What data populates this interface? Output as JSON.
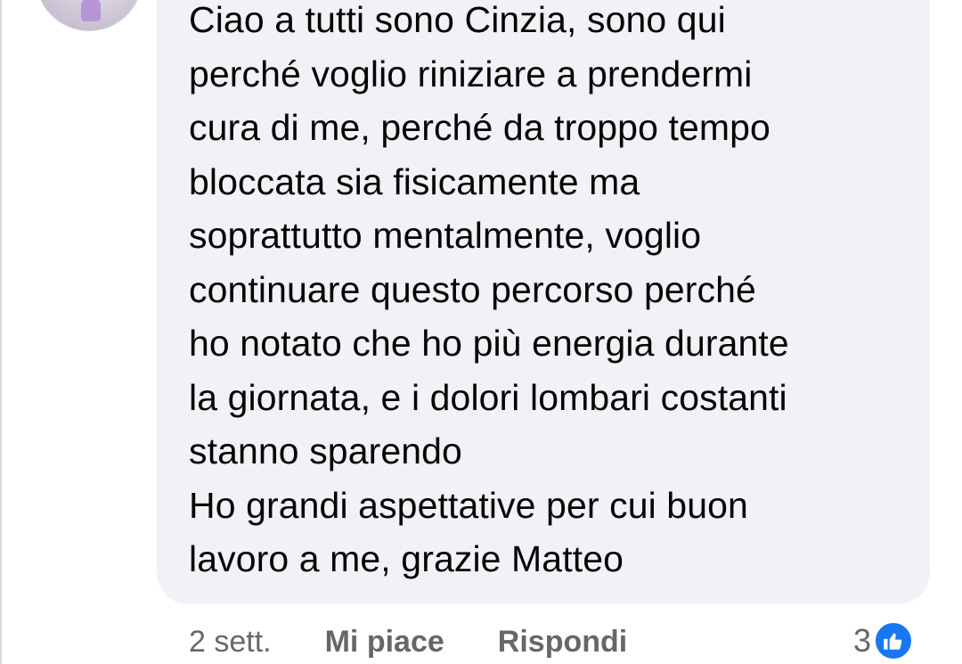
{
  "comment": {
    "text": "Ciao a tutti sono Cinzia, sono qui\nperché voglio riniziare a prendermi\ncura di me, perché da troppo tempo\nbloccata sia fisicamente ma\nsoprattutto mentalmente,  voglio\ncontinuare questo percorso perché\nho notato che ho più energia durante\nla giornata, e i dolori lombari costanti\nstanno sparendo\nHo grandi aspettative per cui buon\nlavoro a me, grazie Matteo"
  },
  "actions": {
    "time": "2 sett.",
    "like_label": "Mi piace",
    "reply_label": "Rispondi"
  },
  "reactions": {
    "count": "3",
    "icon": "like-thumb-icon",
    "icon_color": "#1877f2"
  },
  "colors": {
    "bubble_bg": "#f0f2f5",
    "text": "#050505",
    "secondary_text": "#65676b"
  }
}
